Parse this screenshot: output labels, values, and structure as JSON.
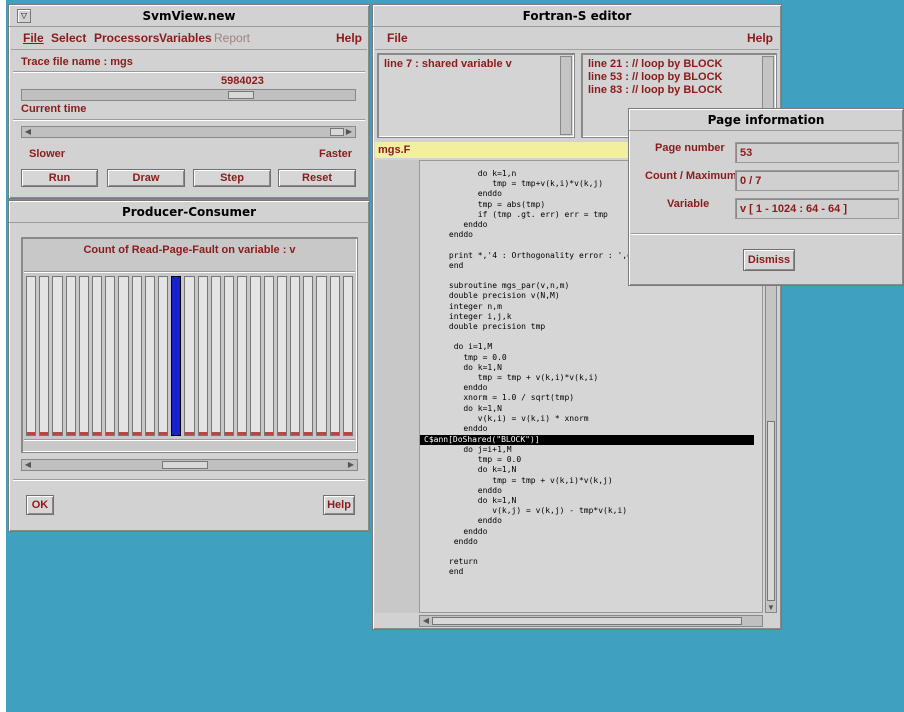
{
  "svmview": {
    "title": "SvmView.new",
    "menu": [
      "File",
      "Select",
      "Processors",
      "Variables",
      "Report",
      "Help"
    ],
    "trace_label": "Trace file name : mgs",
    "slider_value": "5984023",
    "current_time_label": "Current time",
    "slower_label": "Slower",
    "faster_label": "Faster",
    "buttons": {
      "run": "Run",
      "draw": "Draw",
      "step": "Step",
      "reset": "Reset"
    }
  },
  "producer": {
    "title": "Producer-Consumer",
    "chart_caption": "Count of Read-Page-Fault on variable : v",
    "ok_label": "OK",
    "help_label": "Help"
  },
  "editor": {
    "title": "Fortran-S editor",
    "menu_file": "File",
    "menu_help": "Help",
    "left_list": [
      "line  7 : shared variable v"
    ],
    "right_list": [
      "line  21 : // loop by BLOCK",
      "line  53 : // loop by BLOCK",
      "line  83 : // loop by BLOCK"
    ],
    "filename": "mgs.F",
    "code_lines": [
      "            do k=1,n",
      "               tmp = tmp+v(k,i)*v(k,j)",
      "            enddo",
      "            tmp = abs(tmp)",
      "            if (tmp .gt. err) err = tmp",
      "         enddo",
      "      enddo",
      "",
      "      print *,'4 : Orthogonality error : ',err",
      "      end",
      "",
      "      subroutine mgs_par(v,n,m)",
      "      double precision v(N,M)",
      "      integer n,m",
      "      integer i,j,k",
      "      double precision tmp",
      "",
      "       do i=1,M",
      "         tmp = 0.0",
      "         do k=1,N",
      "            tmp = tmp + v(k,i)*v(k,i)",
      "         enddo",
      "         xnorm = 1.0 / sqrt(tmp)",
      "         do k=1,N",
      "            v(k,i) = v(k,i) * xnorm",
      "         enddo"
    ],
    "highlighted_line": "C$ann[DoShared(\"BLOCK\")]",
    "code_lines_after": [
      "         do j=i+1,M",
      "            tmp = 0.0",
      "            do k=1,N",
      "               tmp = tmp + v(k,i)*v(k,j)",
      "            enddo",
      "            do k=1,N",
      "               v(k,j) = v(k,j) - tmp*v(k,i)",
      "            enddo",
      "         enddo",
      "       enddo",
      "",
      "      return",
      "      end"
    ]
  },
  "pageinfo": {
    "title": "Page information",
    "page_number_label": "Page number",
    "page_number_value": "53",
    "count_label": "Count / Maximum",
    "count_value": "0 / 7",
    "variable_label": "Variable",
    "variable_value": "v [ 1 - 1024 : 64 - 64 ]",
    "dismiss_label": "Dismiss"
  },
  "chart_data": {
    "type": "bar",
    "title": "Count of Read-Page-Fault on variable : v",
    "bar_count": 25,
    "highlighted_index": 11
  },
  "colors": {
    "accent_text": "#8b1a1a",
    "highlight_bar": "#1a22d0",
    "desktop": "#3fa0c0"
  }
}
